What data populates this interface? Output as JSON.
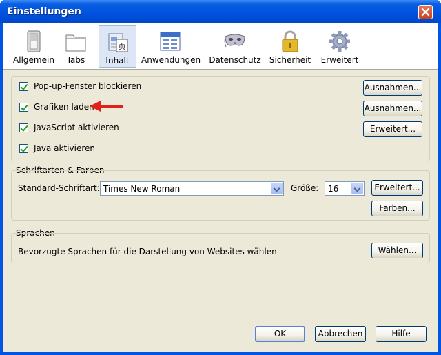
{
  "window": {
    "title": "Einstellungen"
  },
  "toolbar": {
    "items": [
      {
        "label": "Allgemein",
        "icon": "switch-icon",
        "selected": false
      },
      {
        "label": "Tabs",
        "icon": "folder-tabs-icon",
        "selected": false
      },
      {
        "label": "Inhalt",
        "icon": "content-page-icon",
        "selected": true
      },
      {
        "label": "Anwendungen",
        "icon": "applications-window-icon",
        "selected": false
      },
      {
        "label": "Datenschutz",
        "icon": "mask-icon",
        "selected": false
      },
      {
        "label": "Sicherheit",
        "icon": "padlock-icon",
        "selected": false
      },
      {
        "label": "Erweitert",
        "icon": "gear-icon",
        "selected": false
      }
    ]
  },
  "content": {
    "options": [
      {
        "label": "Pop-up-Fenster blockieren",
        "checked": true,
        "button": "Ausnahmen..."
      },
      {
        "label": "Grafiken laden",
        "checked": true,
        "button": "Ausnahmen..."
      },
      {
        "label": "JavaScript aktivieren",
        "checked": true,
        "button": "Erweitert..."
      },
      {
        "label": "Java aktivieren",
        "checked": true
      }
    ]
  },
  "fonts": {
    "title": "Schriftarten & Farben",
    "default_font_label": "Standard-Schriftart:",
    "default_font_value": "Times New Roman",
    "size_label": "Größe:",
    "size_value": "16",
    "advanced_button": "Erweitert...",
    "colors_button": "Farben..."
  },
  "languages": {
    "title": "Sprachen",
    "description": "Bevorzugte Sprachen für die Darstellung von Websites wählen",
    "choose_button": "Wählen..."
  },
  "footer": {
    "ok": "OK",
    "cancel": "Abbrechen",
    "help": "Hilfe"
  },
  "colors": {
    "accent_arrow": "#e3211c",
    "titlebar": "#0053e1",
    "dialog_bg": "#ece9d8"
  }
}
